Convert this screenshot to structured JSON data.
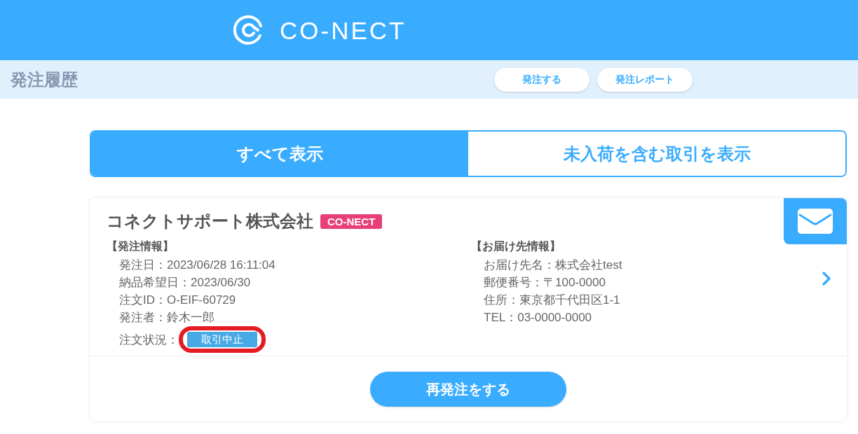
{
  "header": {
    "logo": "CO-NECT"
  },
  "subheader": {
    "title": "発注履歴",
    "buttons": [
      "発注する",
      "発注レポート"
    ]
  },
  "filter_tabs": [
    {
      "label": "すべて表示",
      "selected": true
    },
    {
      "label": "未入荷を含む取引を表示",
      "selected": false
    }
  ],
  "orders": [
    {
      "company": "コネクトサポート株式会社",
      "tag": "CO-NECT",
      "order_info": {
        "heading": "【発注情報】",
        "lines": [
          "発注日：2023/06/28 16:11:04",
          "納品希望日：2023/06/30",
          "注文ID：O-EIF-60729",
          "発注者：鈴木一郎"
        ],
        "status_label": "注文状況：",
        "status": "取引中止",
        "status_highlighted": true
      },
      "delivery_info": {
        "heading": "【お届け先情報】",
        "lines": [
          "お届け先名：株式会社test",
          "郵便番号：〒100-0000",
          "住所：東京都千代田区1-1",
          "TEL：03-0000-0000"
        ]
      },
      "reorder_button": "再発注をする"
    }
  ]
}
